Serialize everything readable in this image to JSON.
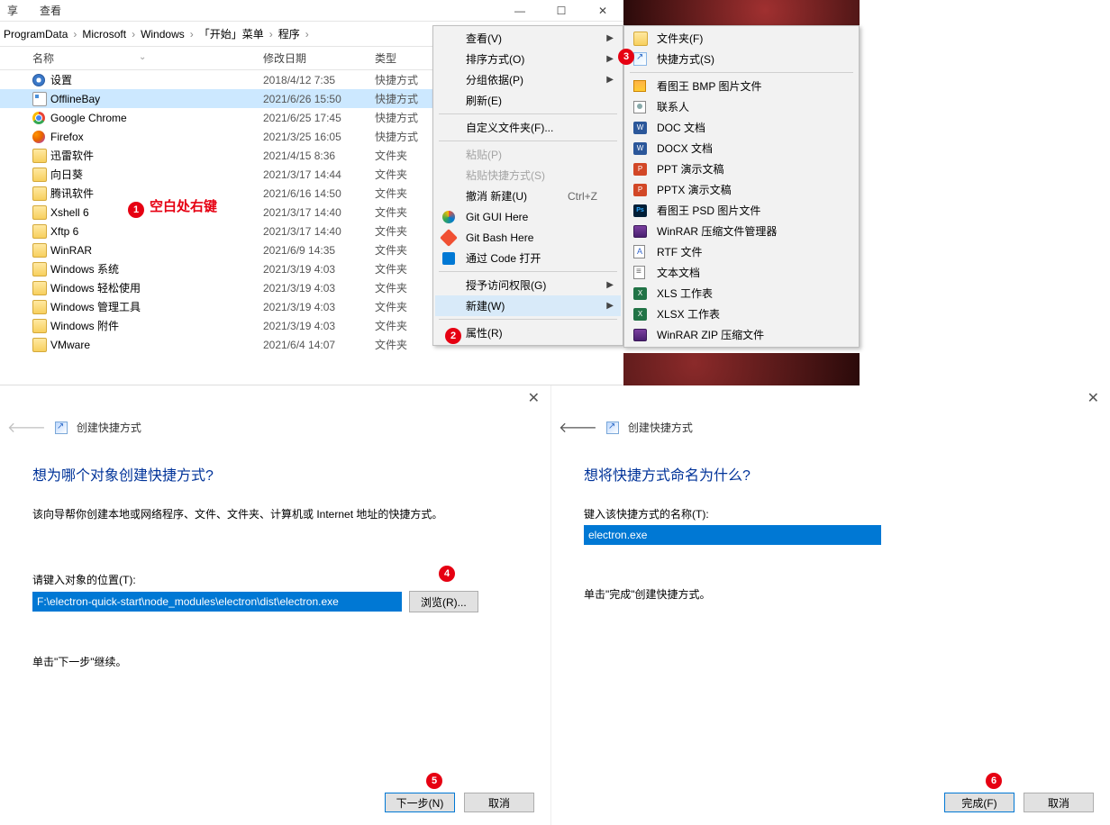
{
  "explorer": {
    "ribbon": {
      "share": "享",
      "view": "查看"
    },
    "breadcrumb": [
      "ProgramData",
      "Microsoft",
      "Windows",
      "「开始」菜单",
      "程序"
    ],
    "columns": {
      "name": "名称",
      "date": "修改日期",
      "type": "类型"
    },
    "files": [
      {
        "icon": "gear",
        "name": "设置",
        "date": "2018/4/12 7:35",
        "type": "快捷方式",
        "sel": false
      },
      {
        "icon": "app",
        "name": "OfflineBay",
        "date": "2021/6/26 15:50",
        "type": "快捷方式",
        "sel": true
      },
      {
        "icon": "chrome",
        "name": "Google Chrome",
        "date": "2021/6/25 17:45",
        "type": "快捷方式",
        "sel": false
      },
      {
        "icon": "ff",
        "name": "Firefox",
        "date": "2021/3/25 16:05",
        "type": "快捷方式",
        "sel": false
      },
      {
        "icon": "folder",
        "name": "迅雷软件",
        "date": "2021/4/15 8:36",
        "type": "文件夹",
        "sel": false
      },
      {
        "icon": "folder",
        "name": "向日葵",
        "date": "2021/3/17 14:44",
        "type": "文件夹",
        "sel": false
      },
      {
        "icon": "folder",
        "name": "腾讯软件",
        "date": "2021/6/16 14:50",
        "type": "文件夹",
        "sel": false
      },
      {
        "icon": "folder",
        "name": "Xshell 6",
        "date": "2021/3/17 14:40",
        "type": "文件夹",
        "sel": false
      },
      {
        "icon": "folder",
        "name": "Xftp 6",
        "date": "2021/3/17 14:40",
        "type": "文件夹",
        "sel": false
      },
      {
        "icon": "folder",
        "name": "WinRAR",
        "date": "2021/6/9 14:35",
        "type": "文件夹",
        "sel": false
      },
      {
        "icon": "folder",
        "name": "Windows 系统",
        "date": "2021/3/19 4:03",
        "type": "文件夹",
        "sel": false
      },
      {
        "icon": "folder",
        "name": "Windows 轻松使用",
        "date": "2021/3/19 4:03",
        "type": "文件夹",
        "sel": false
      },
      {
        "icon": "folder",
        "name": "Windows 管理工具",
        "date": "2021/3/19 4:03",
        "type": "文件夹",
        "sel": false
      },
      {
        "icon": "folder",
        "name": "Windows 附件",
        "date": "2021/3/19 4:03",
        "type": "文件夹",
        "sel": false
      },
      {
        "icon": "folder",
        "name": "VMware",
        "date": "2021/6/4 14:07",
        "type": "文件夹",
        "sel": false
      }
    ],
    "annotation1": "空白处右键"
  },
  "ctx_menu": [
    {
      "t": "item",
      "label": "查看(V)",
      "arrow": true
    },
    {
      "t": "item",
      "label": "排序方式(O)",
      "arrow": true
    },
    {
      "t": "item",
      "label": "分组依据(P)",
      "arrow": true
    },
    {
      "t": "item",
      "label": "刷新(E)"
    },
    {
      "t": "sep"
    },
    {
      "t": "item",
      "label": "自定义文件夹(F)..."
    },
    {
      "t": "sep"
    },
    {
      "t": "item",
      "label": "粘贴(P)",
      "disabled": true
    },
    {
      "t": "item",
      "label": "粘贴快捷方式(S)",
      "disabled": true
    },
    {
      "t": "item",
      "label": "撤消 新建(U)",
      "shortcut": "Ctrl+Z"
    },
    {
      "t": "item",
      "label": "Git GUI Here",
      "icon": "gitblue"
    },
    {
      "t": "item",
      "label": "Git Bash Here",
      "icon": "git"
    },
    {
      "t": "item",
      "label": "通过 Code 打开",
      "icon": "vscode"
    },
    {
      "t": "sep"
    },
    {
      "t": "item",
      "label": "授予访问权限(G)",
      "arrow": true
    },
    {
      "t": "item",
      "label": "新建(W)",
      "arrow": true,
      "highlight": true
    },
    {
      "t": "sep"
    },
    {
      "t": "item",
      "label": "属性(R)"
    }
  ],
  "submenu_new": [
    {
      "t": "item",
      "label": "文件夹(F)",
      "icon": "folder"
    },
    {
      "t": "item",
      "label": "快捷方式(S)",
      "icon": "shortcut"
    },
    {
      "t": "sep"
    },
    {
      "t": "item",
      "label": "看图王 BMP 图片文件",
      "icon": "bmp"
    },
    {
      "t": "item",
      "label": "联系人",
      "icon": "contact"
    },
    {
      "t": "item",
      "label": "DOC 文档",
      "icon": "word"
    },
    {
      "t": "item",
      "label": "DOCX 文档",
      "icon": "word"
    },
    {
      "t": "item",
      "label": "PPT 演示文稿",
      "icon": "ppt"
    },
    {
      "t": "item",
      "label": "PPTX 演示文稿",
      "icon": "ppt"
    },
    {
      "t": "item",
      "label": "看图王 PSD 图片文件",
      "icon": "psd"
    },
    {
      "t": "item",
      "label": "WinRAR 压缩文件管理器",
      "icon": "rar"
    },
    {
      "t": "item",
      "label": "RTF 文件",
      "icon": "rtf"
    },
    {
      "t": "item",
      "label": "文本文档",
      "icon": "txt"
    },
    {
      "t": "item",
      "label": "XLS 工作表",
      "icon": "xls"
    },
    {
      "t": "item",
      "label": "XLSX 工作表",
      "icon": "xls"
    },
    {
      "t": "item",
      "label": "WinRAR ZIP 压缩文件",
      "icon": "rar"
    }
  ],
  "wizard_left": {
    "title_small": "创建快捷方式",
    "heading": "想为哪个对象创建快捷方式?",
    "desc": "该向导帮你创建本地或网络程序、文件、文件夹、计算机或 Internet 地址的快捷方式。",
    "field_label": "请键入对象的位置(T):",
    "field_value": "F:\\electron-quick-start\\node_modules\\electron\\dist\\electron.exe",
    "browse": "浏览(R)...",
    "hint": "单击\"下一步\"继续。",
    "next": "下一步(N)",
    "cancel": "取消"
  },
  "wizard_right": {
    "title_small": "创建快捷方式",
    "heading": "想将快捷方式命名为什么?",
    "field_label": "键入该快捷方式的名称(T):",
    "field_value": "electron.exe",
    "hint": "单击\"完成\"创建快捷方式。",
    "finish": "完成(F)",
    "cancel": "取消"
  }
}
